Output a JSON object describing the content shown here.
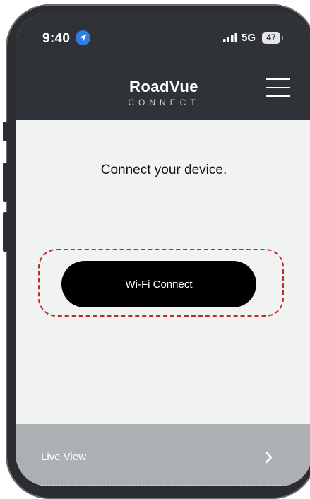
{
  "status_bar": {
    "time": "9:40",
    "network": "5G",
    "battery": "47",
    "icons": [
      "location-arrow-icon",
      "signal-bars-icon",
      "battery-icon"
    ]
  },
  "header": {
    "brand": "RoadVue",
    "brand_sub": "CONNECT",
    "menu_icon": "hamburger-menu-icon"
  },
  "main": {
    "heading": "Connect your device.",
    "wifi_button_label": "Wi-Fi Connect",
    "highlight_color": "#c0292b"
  },
  "bottom_menu": {
    "items": [
      {
        "label": "Live View",
        "icon": "chevron-right-icon"
      }
    ]
  },
  "colors": {
    "header_bg": "#2f3236",
    "content_bg": "#f1f2f2",
    "button_bg": "#000000",
    "bottom_bg": "#adb0b3",
    "location_blue": "#2f7dde"
  }
}
